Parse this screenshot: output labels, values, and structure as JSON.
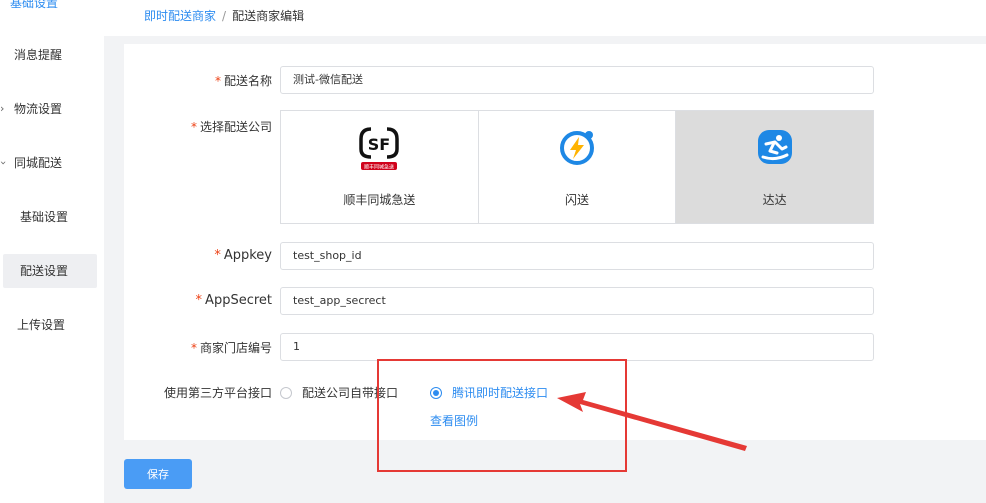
{
  "sidebar": {
    "items": [
      {
        "label": "基础设置"
      },
      {
        "label": "消息提醒"
      },
      {
        "label": "物流设置",
        "arrow": "›"
      },
      {
        "label": "同城配送",
        "arrow": "›"
      },
      {
        "label": "基础设置"
      },
      {
        "label": "配送设置"
      },
      {
        "label": "上传设置"
      }
    ]
  },
  "breadcrumb": {
    "parent": "即时配送商家",
    "separator": "/",
    "current": "配送商家编辑"
  },
  "form": {
    "name": {
      "required": "*",
      "label": "配送名称",
      "value": "测试-微信配送"
    },
    "company": {
      "required": "*",
      "label": "选择配送公司",
      "options": [
        {
          "name": "顺丰同城急送",
          "logo_text": "SF",
          "logo_sub": "顺丰同城急送",
          "color": "#111111",
          "accent": "#d0021b"
        },
        {
          "name": "闪送",
          "color": "#1e88e5",
          "accent": "#ffb300"
        },
        {
          "name": "达达",
          "color": "#1e88e5"
        }
      ],
      "selected": "达达"
    },
    "appkey": {
      "required": "*",
      "label": "Appkey",
      "value": "test_shop_id"
    },
    "appsecret": {
      "required": "*",
      "label": "AppSecret",
      "value": "test_app_secrect"
    },
    "store_no": {
      "required": "*",
      "label": "商家门店编号",
      "value": "1"
    },
    "third_party": {
      "label": "使用第三方平台接口",
      "options": [
        {
          "label": "配送公司自带接口",
          "checked": false
        },
        {
          "label": "腾讯即时配送接口",
          "checked": true
        }
      ],
      "example_link": "查看图例"
    }
  },
  "actions": {
    "save_label": "保存"
  },
  "colors": {
    "primary": "#2d8cf0",
    "required": "#ed4014",
    "annotation": "#e53935"
  }
}
